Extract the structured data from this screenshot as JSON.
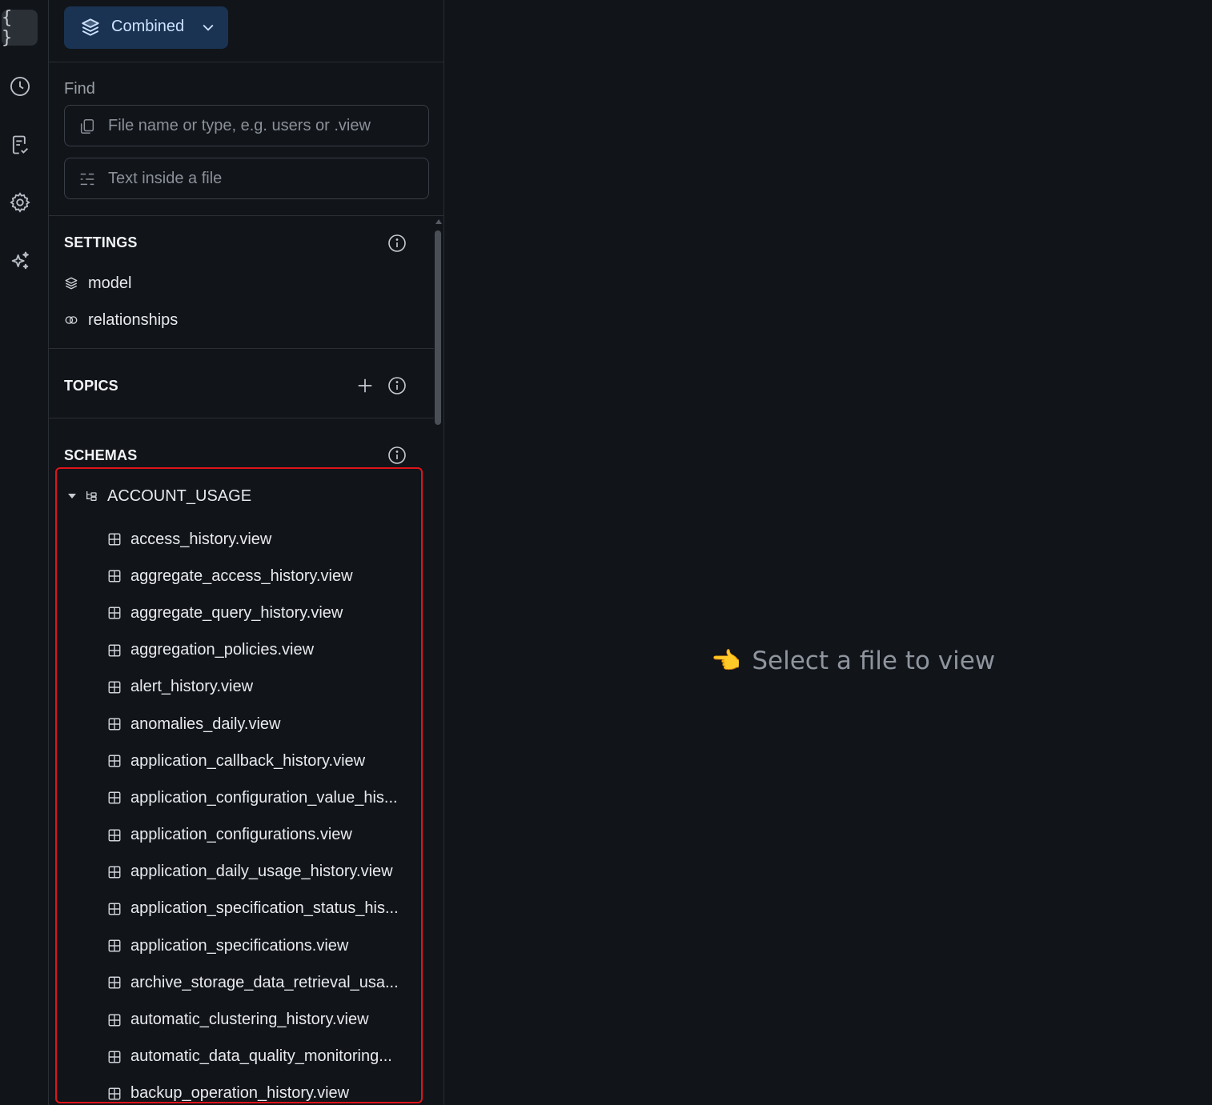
{
  "rail": {
    "items": [
      {
        "name": "code-braces",
        "glyph": "{ }",
        "active": true
      },
      {
        "name": "history"
      },
      {
        "name": "validation"
      },
      {
        "name": "settings"
      },
      {
        "name": "ai-sparkle"
      }
    ]
  },
  "header": {
    "mode_label": "Combined",
    "mode_color": "#1a3352"
  },
  "find": {
    "label": "Find",
    "file_placeholder": "File name or type, e.g. users or .view",
    "text_placeholder": "Text inside a file"
  },
  "settings": {
    "title": "SETTINGS",
    "items": [
      "model",
      "relationships"
    ]
  },
  "topics": {
    "title": "TOPICS"
  },
  "schemas": {
    "title": "SCHEMAS",
    "root": "ACCOUNT_USAGE",
    "files": [
      "access_history.view",
      "aggregate_access_history.view",
      "aggregate_query_history.view",
      "aggregation_policies.view",
      "alert_history.view",
      "anomalies_daily.view",
      "application_callback_history.view",
      "application_configuration_value_his...",
      "application_configurations.view",
      "application_daily_usage_history.view",
      "application_specification_status_his...",
      "application_specifications.view",
      "archive_storage_data_retrieval_usa...",
      "automatic_clustering_history.view",
      "automatic_data_quality_monitoring...",
      "backup_operation_history.view"
    ]
  },
  "main": {
    "emoji": "👈",
    "empty_message": "Select a file to view"
  },
  "colors": {
    "background": "#111419",
    "highlight": "#e0141b",
    "accent": "#1a3352"
  }
}
